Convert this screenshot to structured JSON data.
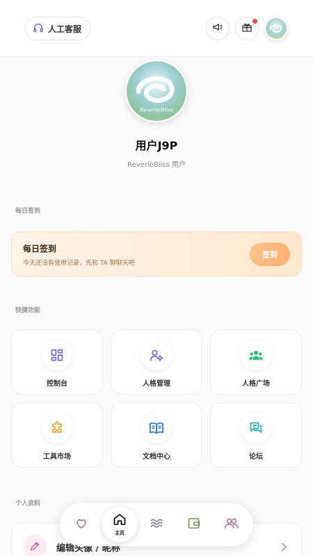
{
  "header": {
    "support_label": "人工客服",
    "icons": [
      "headset-icon",
      "megaphone-icon",
      "gift-icon"
    ],
    "gift_has_notification": true
  },
  "profile": {
    "avatar_text": "ReverieBliss",
    "username": "用户J9P",
    "subtitle": "ReverieBliss 用户"
  },
  "sections": {
    "daily_checkin": "每日签到",
    "quick_functions": "快捷功能",
    "personal_info": "个人资料"
  },
  "checkin": {
    "title": "每日签到",
    "description": "今天还没有使用记录，先和 TA 聊聊天吧",
    "button_label": "签到"
  },
  "quick_functions": [
    {
      "label": "控制台",
      "icon": "dashboard-icon",
      "color": "#6c63e6"
    },
    {
      "label": "人格管理",
      "icon": "user-settings-icon",
      "color": "#6c63e6"
    },
    {
      "label": "人格广场",
      "icon": "group-icon",
      "color": "#2bb673"
    },
    {
      "label": "工具市场",
      "icon": "puzzle-icon",
      "color": "#f0a020"
    },
    {
      "label": "文档中心",
      "icon": "book-icon",
      "color": "#3a7bd5"
    },
    {
      "label": "论坛",
      "icon": "chat-icon",
      "color": "#1fb0b0"
    }
  ],
  "personal_info": {
    "edit_label": "编辑头像 / 昵称",
    "icon": "pencil-icon"
  },
  "bottom_nav": {
    "items": [
      "heart-icon",
      "home-icon",
      "waves-icon",
      "wallet-icon",
      "people-icon"
    ],
    "home_label": "主页"
  },
  "colors": {
    "accent": "#6c63e6",
    "checkin_button": "#ffb074",
    "notification_dot": "#e74c3c"
  }
}
